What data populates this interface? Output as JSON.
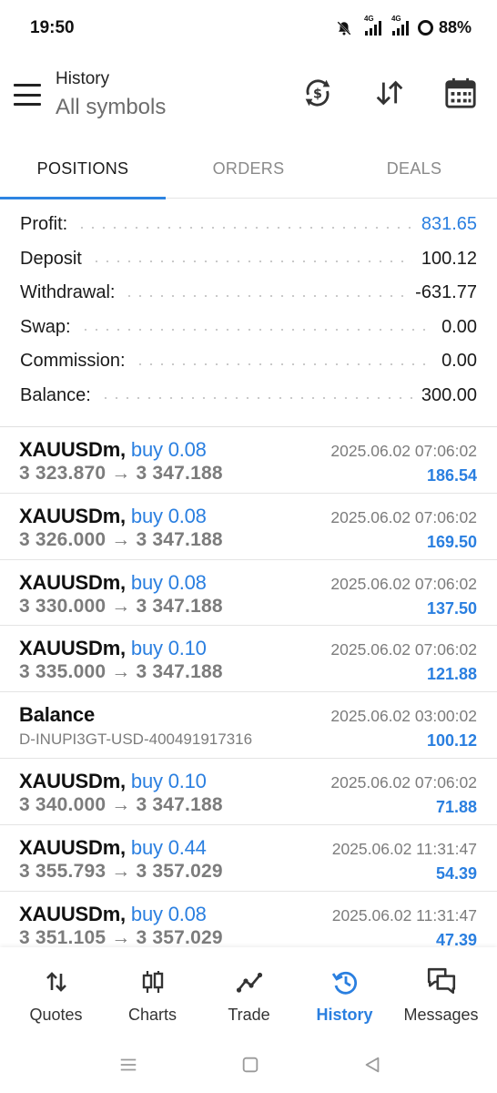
{
  "status": {
    "time": "19:50",
    "signal1": "4G",
    "signal2": "4G",
    "battery": "88%"
  },
  "header": {
    "title": "History",
    "subtitle": "All symbols"
  },
  "tabs": [
    {
      "label": "POSITIONS",
      "active": true
    },
    {
      "label": "ORDERS",
      "active": false
    },
    {
      "label": "DEALS",
      "active": false
    }
  ],
  "summary": {
    "profit_label": "Profit:",
    "profit_value": "831.65",
    "deposit_label": "Deposit",
    "deposit_value": "100.12",
    "withdrawal_label": "Withdrawal:",
    "withdrawal_value": "-631.77",
    "swap_label": "Swap:",
    "swap_value": "0.00",
    "commission_label": "Commission:",
    "commission_value": "0.00",
    "balance_label": "Balance:",
    "balance_value": "300.00"
  },
  "deals": [
    {
      "symbol": "XAUUSDm,",
      "side": "buy 0.08",
      "prices": "3 323.870 → 3 347.188",
      "time": "2025.06.02 07:06:02",
      "profit": "186.54"
    },
    {
      "symbol": "XAUUSDm,",
      "side": "buy 0.08",
      "prices": "3 326.000 → 3 347.188",
      "time": "2025.06.02 07:06:02",
      "profit": "169.50"
    },
    {
      "symbol": "XAUUSDm,",
      "side": "buy 0.08",
      "prices": "3 330.000 → 3 347.188",
      "time": "2025.06.02 07:06:02",
      "profit": "137.50"
    },
    {
      "symbol": "XAUUSDm,",
      "side": "buy 0.10",
      "prices": "3 335.000 → 3 347.188",
      "time": "2025.06.02 07:06:02",
      "profit": "121.88"
    },
    {
      "symbol": "Balance",
      "comment": "D-INUPI3GT-USD-400491917316",
      "time": "2025.06.02 03:00:02",
      "profit": "100.12"
    },
    {
      "symbol": "XAUUSDm,",
      "side": "buy 0.10",
      "prices": "3 340.000 → 3 347.188",
      "time": "2025.06.02 07:06:02",
      "profit": "71.88"
    },
    {
      "symbol": "XAUUSDm,",
      "side": "buy 0.44",
      "prices": "3 355.793 → 3 357.029",
      "time": "2025.06.02 11:31:47",
      "profit": "54.39"
    },
    {
      "symbol": "XAUUSDm,",
      "side": "buy 0.08",
      "prices": "3 351.105 → 3 357.029",
      "time": "2025.06.02 11:31:47",
      "profit": "47.39"
    }
  ],
  "nav": [
    {
      "label": "Quotes",
      "icon": "quotes-icon",
      "active": false
    },
    {
      "label": "Charts",
      "icon": "charts-icon",
      "active": false
    },
    {
      "label": "Trade",
      "icon": "trade-icon",
      "active": false
    },
    {
      "label": "History",
      "icon": "history-icon",
      "active": true
    },
    {
      "label": "Messages",
      "icon": "messages-icon",
      "active": false
    }
  ],
  "colors": {
    "accent": "#2a7fe0",
    "muted": "#7c7c7c",
    "text": "#111111"
  }
}
